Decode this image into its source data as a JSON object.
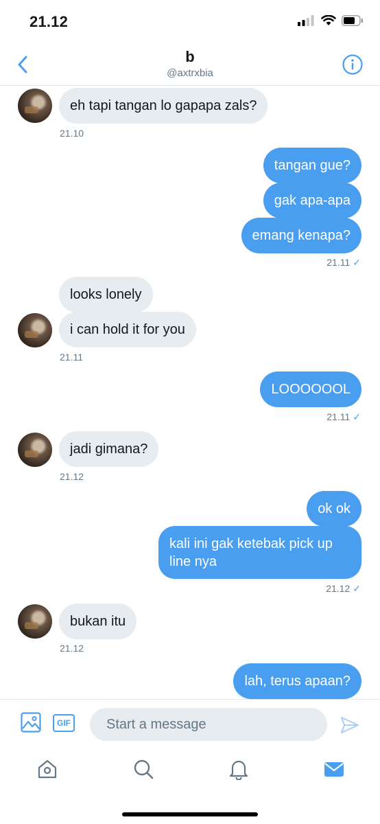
{
  "status_bar": {
    "time": "21.12"
  },
  "header": {
    "name": "b",
    "handle": "@axtrxbia"
  },
  "messages": [
    {
      "text": "eh tapi tangan lo gapapa zals?"
    },
    {
      "time": "21.10"
    },
    {
      "text": "tangan gue?"
    },
    {
      "text": "gak apa-apa"
    },
    {
      "text": "emang kenapa?"
    },
    {
      "time": "21.11"
    },
    {
      "text": "looks lonely"
    },
    {
      "text": "i can hold it for you"
    },
    {
      "time": "21.11"
    },
    {
      "text": "LOOOOOOL"
    },
    {
      "time": "21.11"
    },
    {
      "text": "jadi gimana?"
    },
    {
      "time": "21.12"
    },
    {
      "text": "ok ok"
    },
    {
      "text": "kali ini gak ketebak pick up line nya"
    },
    {
      "time": "21.12"
    },
    {
      "text": "bukan itu"
    },
    {
      "time": "21.12"
    },
    {
      "text": "lah, terus apaan?"
    }
  ],
  "composer": {
    "placeholder": "Start a message",
    "gif_label": "GIF"
  },
  "colors": {
    "accent": "#4a9eef",
    "incoming_bubble": "#e6ecf0",
    "secondary_text": "#657786"
  },
  "icons": [
    "back-chevron-icon",
    "info-icon",
    "image-icon",
    "gif-icon",
    "send-icon",
    "home-icon",
    "search-icon",
    "notifications-icon",
    "messages-icon"
  ]
}
